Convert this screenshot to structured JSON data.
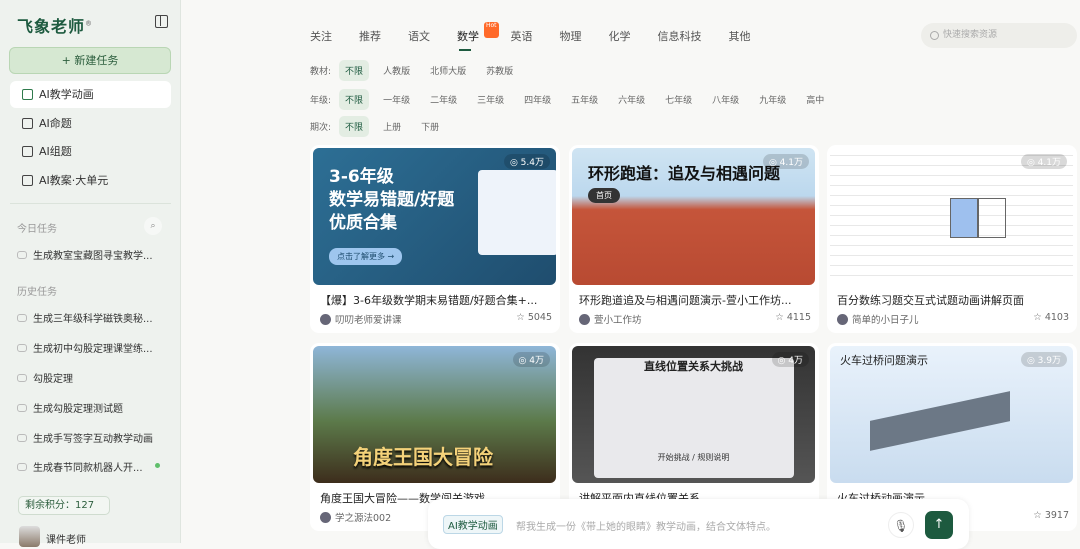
{
  "sidebar": {
    "logo": "飞象老师",
    "logo_mark": "®",
    "new_task": "+ 新建任务",
    "nav": [
      {
        "label": "AI教学动画"
      },
      {
        "label": "AI命题"
      },
      {
        "label": "AI组题"
      },
      {
        "label": "AI教案·大单元"
      }
    ],
    "today_label": "今日任务",
    "today": [
      "生成教室宝藏图寻宝教学..."
    ],
    "history_label": "历史任务",
    "history": [
      "生成三年级科学磁铁奥秘...",
      "生成初中勾股定理课堂练...",
      "勾股定理",
      "生成勾股定理测试题",
      "生成手写签字互动教学动画",
      "生成春节同款机器人开..."
    ],
    "credits": "剩余积分：127",
    "user": "课件老师"
  },
  "tabs": [
    {
      "label": "关注"
    },
    {
      "label": "推荐"
    },
    {
      "label": "语文"
    },
    {
      "label": "数学",
      "badge": "Hot"
    },
    {
      "label": "英语"
    },
    {
      "label": "物理"
    },
    {
      "label": "化学"
    },
    {
      "label": "信息科技"
    },
    {
      "label": "其他"
    }
  ],
  "search_placeholder": "快速搜索资源",
  "filters": [
    {
      "label": "教材:",
      "options": [
        "不限",
        "人教版",
        "北师大版",
        "苏教版"
      ]
    },
    {
      "label": "年级:",
      "options": [
        "不限",
        "一年级",
        "二年级",
        "三年级",
        "四年级",
        "五年级",
        "六年级",
        "七年级",
        "八年级",
        "九年级",
        "高中"
      ]
    },
    {
      "label": "期次:",
      "options": [
        "不限",
        "上册",
        "下册"
      ]
    }
  ],
  "cards": [
    {
      "title": "【爆】3-6年级数学期末易错题/好题合集+...",
      "author": "叨叨老师爱讲课",
      "stars": "☆ 5045",
      "views": "◎ 5.4万",
      "thumb_text": "3-6年级\n数学易错题/好题\n优质合集",
      "thumb_sub": "点击了解更多 →"
    },
    {
      "title": "环形跑道追及与相遇问题演示-萱小工作坊...",
      "author": "萱小工作坊",
      "stars": "☆ 4115",
      "views": "◎ 4.1万",
      "thumb_text": "环形跑道：追及与相遇问题",
      "thumb_sub": "首页"
    },
    {
      "title": "百分数练习题交互式试题动画讲解页面",
      "author": "简单的小日子儿",
      "stars": "☆ 4103",
      "views": "◎ 4.1万",
      "thumb_text": "",
      "thumb_sub": ""
    },
    {
      "title": "角度王国大冒险——数学闯关游戏",
      "author": "学之源法002",
      "stars": "",
      "views": "◎ 4万",
      "thumb_text": "角度王国大冒险",
      "thumb_sub": ""
    },
    {
      "title": "讲解平面内直线位置关系",
      "author": "",
      "stars": "",
      "views": "◎ 4万",
      "thumb_text": "直线位置关系大挑战",
      "thumb_sub": "开始挑战 / 规则说明"
    },
    {
      "title": "火车过桥动画演示",
      "author": "",
      "stars": "☆ 3917",
      "views": "◎ 3.9万",
      "thumb_text": "火车过桥问题演示",
      "thumb_sub": ""
    }
  ],
  "composer": {
    "chip": "AI教学动画",
    "placeholder": "帮我生成一份《带上她的眼睛》教学动画，结合文体特点。",
    "mic": "🎙",
    "send": "↑"
  }
}
